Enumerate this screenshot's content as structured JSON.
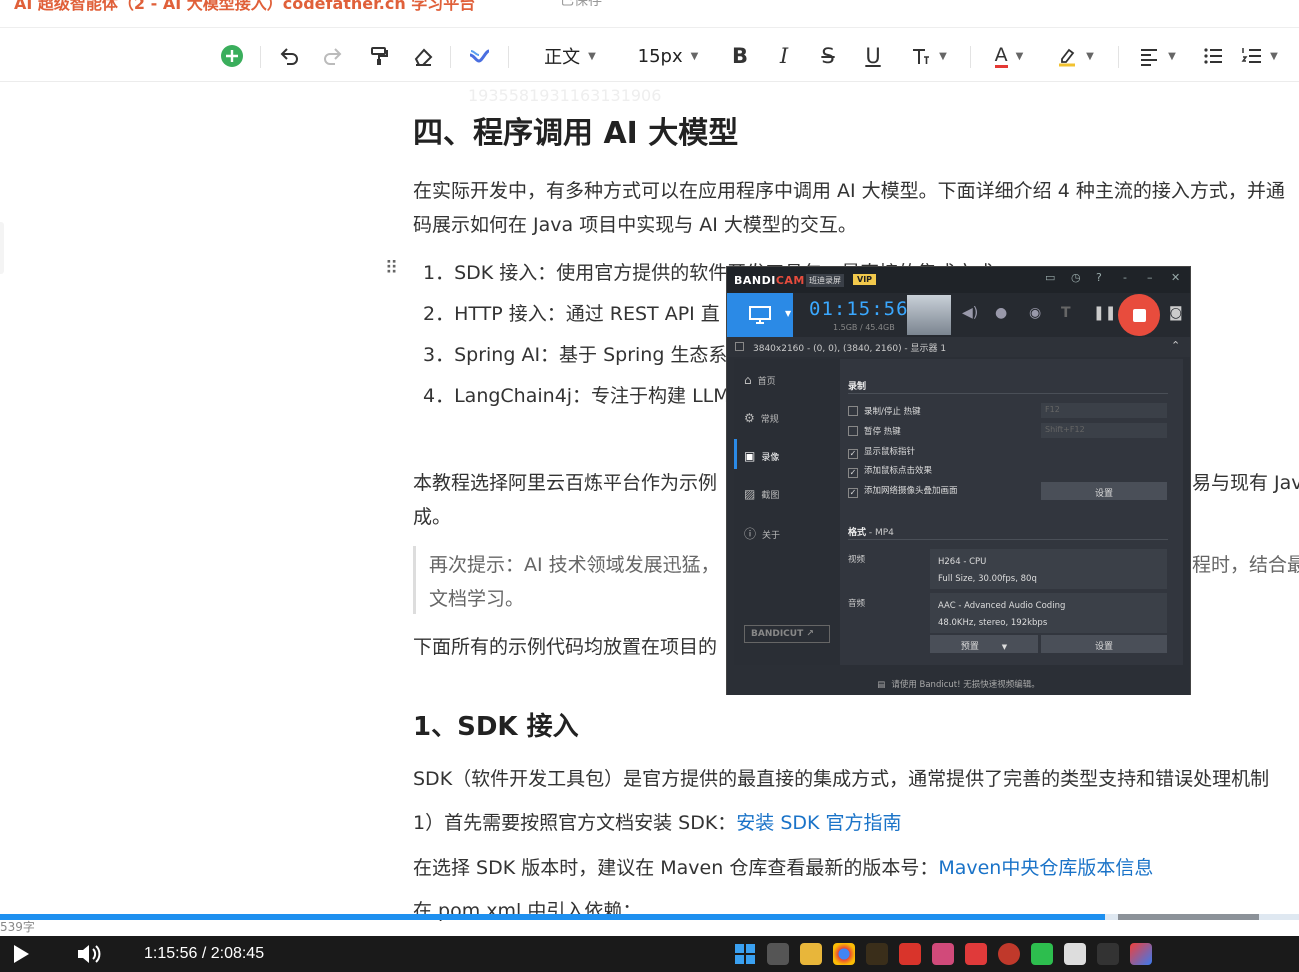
{
  "title_strip": {
    "title": "AI 超级智能体（2 - AI 大模型接入）codefather.cn 学习平台",
    "crumb": "已保存"
  },
  "toolbar": {
    "paragraph_style": "正文",
    "font_size": "15px",
    "icons": [
      "add-icon",
      "undo-icon",
      "redo-icon",
      "format-painter-icon",
      "eraser-icon",
      "ai-brand-icon",
      "bold-icon",
      "italic-icon",
      "strikethrough-icon",
      "underline-icon",
      "text-size-icon",
      "font-color-icon",
      "highlight-icon",
      "align-icon",
      "bullet-list-icon",
      "numbered-list-icon"
    ],
    "bold": "B",
    "italic": "I",
    "strike": "S",
    "underline": "U",
    "font_color": "A"
  },
  "doc": {
    "watermark": "1935581931163131906",
    "h1": "四、程序调用 AI 大模型",
    "intro_1": "在实际开发中，有多种方式可以在应用程序中调用 AI 大模型。下面详细介绍 4 种主流的接入方式，并通",
    "intro_2": "码展示如何在 Java 项目中实现与 AI 大模型的交互。",
    "list": [
      "1．SDK 接入：使用官方提供的软件开发工具包，最直接的集成方式",
      "2．HTTP 接入：通过 REST API 直",
      "3．Spring AI：基于 Spring 生态系",
      "4．LangChain4j：专注于构建 LLM"
    ],
    "para2_1a": "本教程选择阿里云百炼平台作为示例",
    "para2_1b": "易与现有 Jav",
    "para2_2": "成。",
    "quote_1a": "再次提示：AI 技术领域发展迅猛，",
    "quote_1b": "程时，结合最",
    "quote_2": "文档学习。",
    "para3": "下面所有的示例代码均放置在项目的",
    "h2": "1、SDK 接入",
    "sdk_1": "SDK（软件开发工具包）是官方提供的最直接的集成方式，通常提供了完善的类型支持和错误处理机制",
    "sdk_2_text": "1）首先需要按照官方文档安装 SDK：",
    "sdk_2_link": "安装 SDK 官方指南",
    "sdk_3_text": "在选择 SDK 版本时，建议在 Maven 仓库查看最新的版本号：",
    "sdk_3_link": "Maven中央仓库版本信息",
    "sdk_4": "在 pom.xml 中引入依赖："
  },
  "bandicam": {
    "logo_a": "BANDI",
    "logo_b": "CAM",
    "sub": "班迪录屏",
    "vip": "VIP",
    "timer": "01:15:56",
    "size": "1.5GB / 45.4GB",
    "resolution": "3840x2160 - (0, 0), (3840, 2160) - 显示器 1",
    "nav": [
      "首页",
      "常规",
      "录像",
      "截图",
      "关于"
    ],
    "section_record": "录制",
    "checks": [
      {
        "label": "录制/停止 热键",
        "checked": false,
        "hotkey": "F12"
      },
      {
        "label": "暂停 热键",
        "checked": false,
        "hotkey": "Shift+F12"
      },
      {
        "label": "显示鼠标指针",
        "checked": true
      },
      {
        "label": "添加鼠标点击效果",
        "checked": true
      },
      {
        "label": "添加网络摄像头叠加画面",
        "checked": true
      }
    ],
    "settings_btn": "设置",
    "format_label": "格式",
    "format_value": " - MP4",
    "video_label": "视频",
    "video_1": "H264 - CPU",
    "video_2": "Full Size, 30.00fps, 80q",
    "audio_label": "音频",
    "audio_1": "AAC - Advanced Audio Coding",
    "audio_2": "48.0KHz, stereo, 192kbps",
    "preset_btn": "预置",
    "settings_btn2": "设置",
    "bandicut": "BANDICUT",
    "footer": "请使用 Bandicut! 无损快速视频编辑。"
  },
  "player": {
    "time": "1:15:56 / 2:08:45",
    "progress": 0.85,
    "word_count": "539字"
  }
}
